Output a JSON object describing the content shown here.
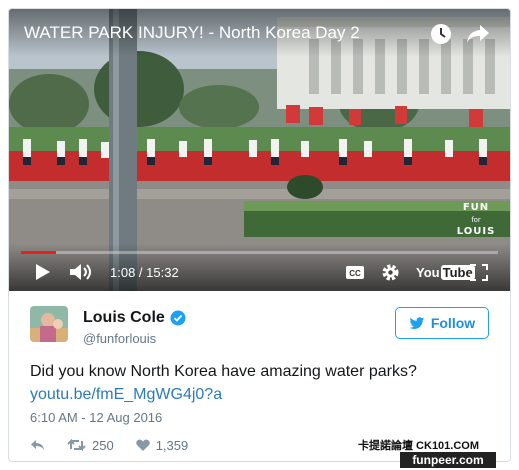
{
  "video": {
    "title": "WATER PARK INJURY! - North Korea Day 2",
    "watermark_line1": "FUN",
    "watermark_line2": "for",
    "watermark_line3": "LOUIS",
    "current_time": "1:08",
    "time_separator": " / ",
    "duration": "15:32",
    "progress_fraction": 0.073,
    "youtube_you": "You",
    "youtube_tube": "Tube",
    "icons": [
      "watch-later-icon",
      "share-icon",
      "play-icon",
      "volume-icon",
      "captions-icon",
      "settings-icon",
      "fullscreen-icon"
    ]
  },
  "tweet": {
    "display_name": "Louis Cole",
    "handle": "@funforlouis",
    "follow_label": "Follow",
    "text": "Did you know North Korea have amazing water parks?",
    "link": "youtu.be/fmE_MgWG4j0?a",
    "timestamp": "6:10 AM - 12 Aug 2016",
    "retweets": "250",
    "likes": "1,359",
    "accent_color": "#1da1f2"
  },
  "watermarks": {
    "site_cn": "卡提諾論壇 CK101.COM",
    "site2": "funpeer.com"
  }
}
